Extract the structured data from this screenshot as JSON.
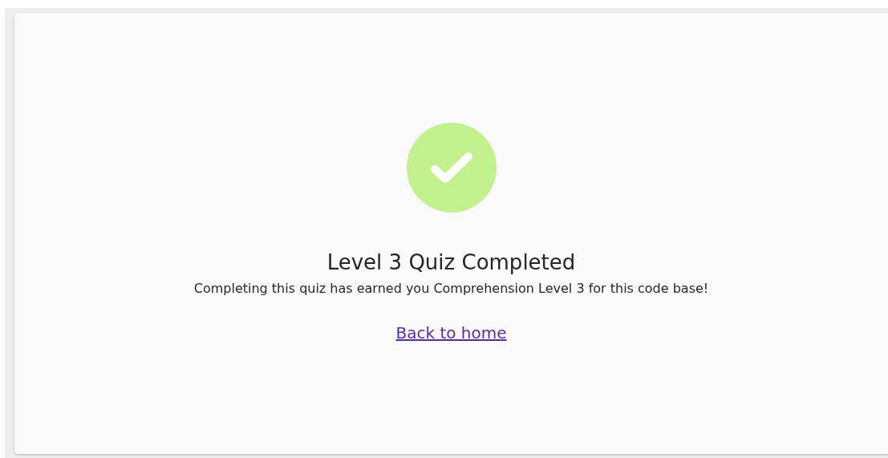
{
  "result": {
    "passed": true,
    "title": "Level 3 Quiz Completed",
    "message": "Completing this quiz has earned you Comprehension Level 3 for this code base!"
  },
  "link": {
    "label": "Back to home"
  }
}
